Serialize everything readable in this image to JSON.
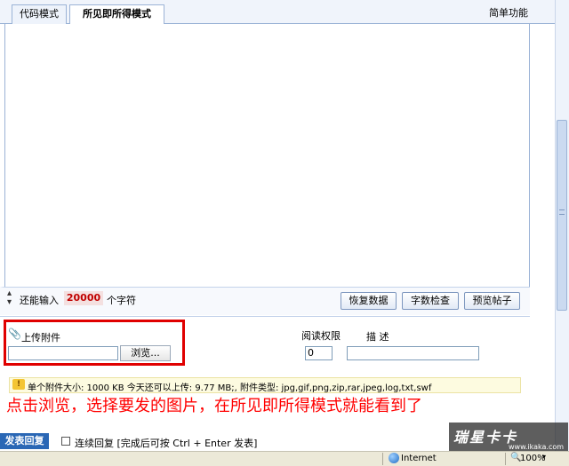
{
  "tabs": {
    "code_mode": "代码模式",
    "wysiwyg_mode": "所见即所得模式"
  },
  "toolbar": {
    "simple_func": "简单功能"
  },
  "counter": {
    "remain_label": "还能输入",
    "remain_value": "20000",
    "chars_label": "个字符"
  },
  "buttons": {
    "restore": "恢复数据",
    "word_check": "字数检查",
    "preview": "预览帖子"
  },
  "attachment": {
    "label": "上传附件",
    "browse": "浏览...",
    "permission_label": "阅读权限",
    "permission_value": "0",
    "description_label": "描 述"
  },
  "info": {
    "text": "单个附件大小: 1000 KB  今天还可以上传: 9.77 MB;, 附件类型: jpg,gif,png,zip,rar,jpeg,log,txt,swf"
  },
  "caption": "点击浏览，选择要发的图片，在所见即所得模式就能看到了",
  "reply": {
    "submit": "发表回复",
    "continue_label": "连续回复 [完成后可按 Ctrl + Enter 发表]"
  },
  "watermark": {
    "logo": "瑞星卡卡",
    "url": "www.ikaka.com"
  },
  "statusbar": {
    "zone": "Internet",
    "zoom": "100%"
  }
}
